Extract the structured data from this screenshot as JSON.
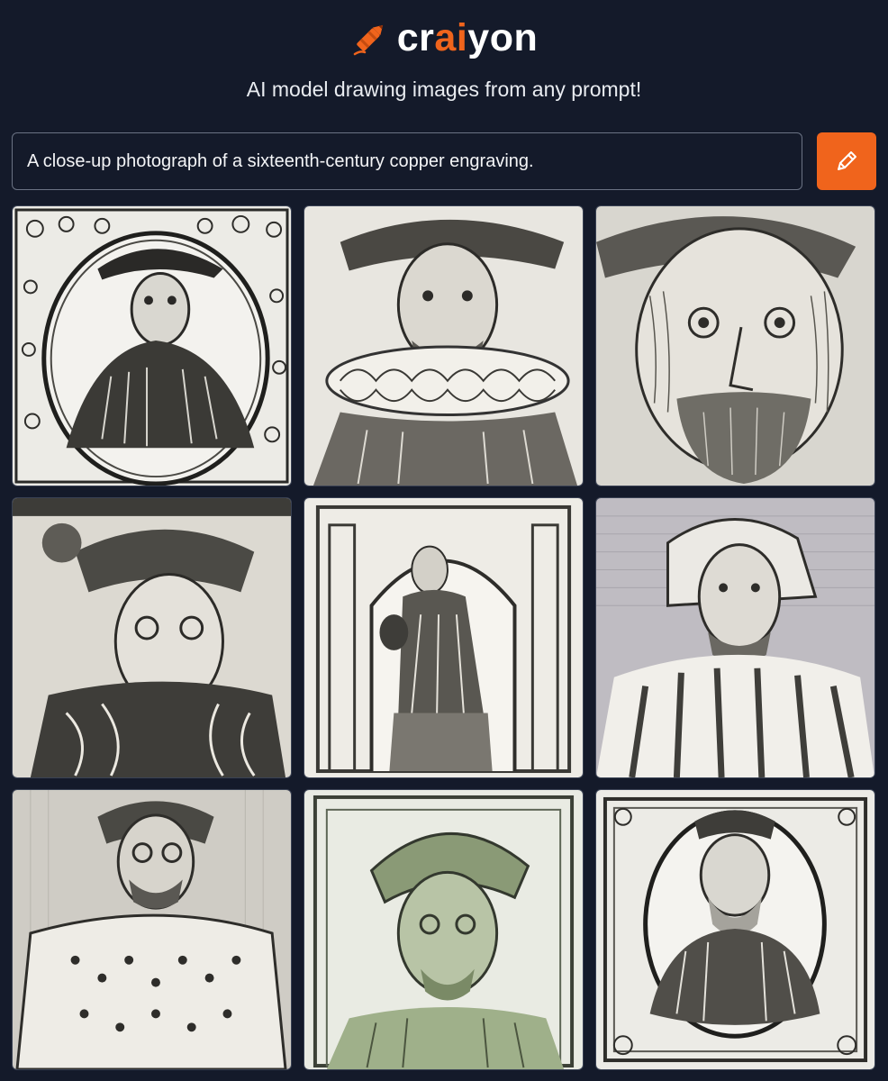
{
  "brand": {
    "name_prefix": "cr",
    "name_accent": "ai",
    "name_suffix": "yon",
    "accent_color": "#f0641c",
    "logo_icon": "crayon-icon"
  },
  "tagline": "AI model drawing images from any prompt!",
  "prompt": {
    "value": "A close-up photograph of a sixteenth-century copper engraving.",
    "button_icon": "pencil-icon"
  },
  "results": {
    "images": [
      {
        "subject": "engraved portrait in oval frame with feathered hat"
      },
      {
        "subject": "engraved portrait with large ruff collar"
      },
      {
        "subject": "engraved close-up portrait of bearded man in cap"
      },
      {
        "subject": "engraved portrait with flat plumed cap and fur collar"
      },
      {
        "subject": "engraved full figure in arched doorway"
      },
      {
        "subject": "engraved portrait with hood and striped robe"
      },
      {
        "subject": "engraved portrait in patterned doublet"
      },
      {
        "subject": "green-tinted engraved portrait in ornamental border"
      },
      {
        "subject": "engraved portrait of man in oval cartouche"
      }
    ]
  }
}
